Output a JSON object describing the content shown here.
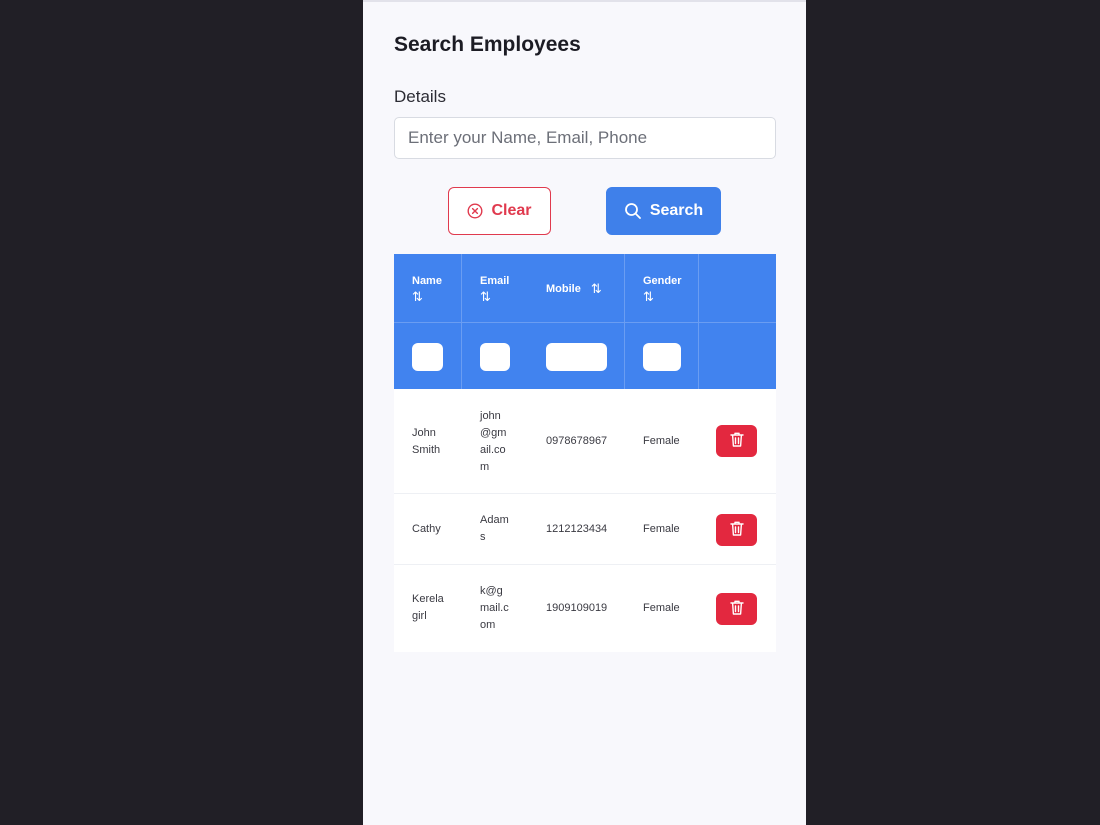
{
  "page": {
    "title": "Search Employees"
  },
  "search": {
    "label": "Details",
    "placeholder": "Enter your Name, Email, Phone",
    "clear_label": "Clear",
    "search_label": "Search"
  },
  "table": {
    "columns": [
      {
        "label": "Name",
        "sort": "⇅"
      },
      {
        "label": "Email",
        "sort": "⇅"
      },
      {
        "label": "Mobile",
        "sort": "⇅"
      },
      {
        "label": "Gender",
        "sort": "⇅"
      }
    ],
    "rows": [
      {
        "name_lines": [
          "John",
          "Smith"
        ],
        "email_lines": [
          "john",
          "@gm",
          "ail.co",
          "m"
        ],
        "mobile": "0978678967",
        "gender": "Female"
      },
      {
        "name_lines": [
          "Cathy"
        ],
        "email_lines": [
          "Adam",
          "s"
        ],
        "mobile": "1212123434",
        "gender": "Female"
      },
      {
        "name_lines": [
          "Kerela",
          "girl"
        ],
        "email_lines": [
          "k@g",
          "mail.c",
          "om"
        ],
        "mobile": "1909109019",
        "gender": "Female"
      }
    ]
  },
  "colors": {
    "header_blue": "#4183ef",
    "danger_red": "#e3283f",
    "primary_blue": "#3f80ea"
  },
  "icons": {
    "clear": "x-circle-icon",
    "search": "search-icon",
    "delete": "trash-icon"
  }
}
